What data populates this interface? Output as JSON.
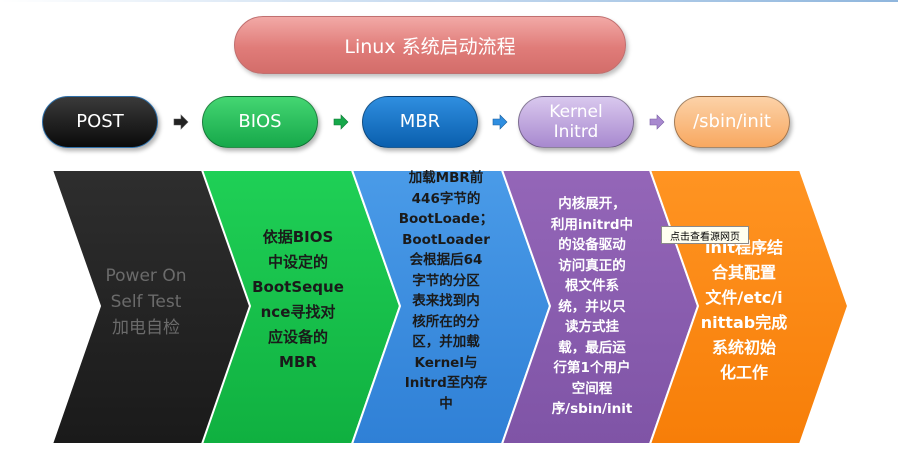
{
  "title": "Linux 系统启动流程",
  "stages": [
    {
      "label": "POST"
    },
    {
      "label": "BIOS"
    },
    {
      "label": "MBR"
    },
    {
      "label": "Kernel\nInitrd"
    },
    {
      "label": "/sbin/init"
    }
  ],
  "panels": [
    {
      "text": "Power On\nSelf Test\n加电自检",
      "color": "#252525",
      "text_color": "#6b6b6b"
    },
    {
      "text": "依据BIOS\n中设定的\nBootSeque\nnce寻找对\n应设备的\nMBR",
      "color": "#16c24a",
      "text_color": "#1a1a1a"
    },
    {
      "text": "加载MBR前\n446字节的\nBootLoade；\nBootLoader\n会根据后64\n字节的分区\n表来找到内\n核所在的分\n区，并加载\nKernel与\nInitrd至内存\n中",
      "color": "#3e8fe0",
      "text_color": "#1a1a1a"
    },
    {
      "text": "内核展开，\n利用initrd中\n的设备驱动\n访问真正的\n根文件系\n统，并以只\n读方式挂\n载，最后运\n行第1个用户\n空间程\n序/sbin/init",
      "color": "#8c5fb0",
      "text_color": "#ffffff"
    },
    {
      "text": "init程序结\n合其配置\n文件/etc/i\nnittab完成\n系统初始\n化工作",
      "color": "#ff8a12",
      "text_color": "#ffffff"
    }
  ],
  "tooltip": "点击查看源网页",
  "colors": {
    "stage_arrow_1": "#222222",
    "stage_arrow_2": "#16a84a",
    "stage_arrow_3": "#2f8ee0",
    "stage_arrow_4": "#a889cf"
  }
}
